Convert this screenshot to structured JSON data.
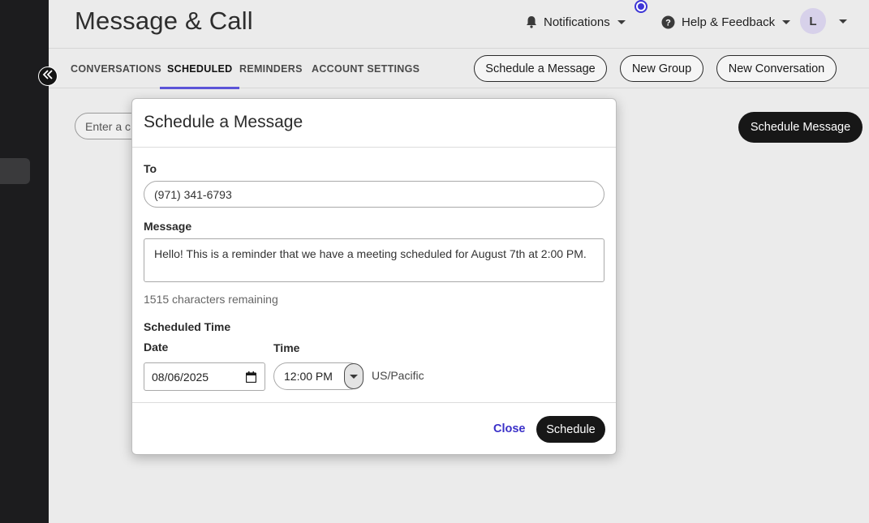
{
  "header": {
    "title": "Message & Call",
    "notifications_label": "Notifications",
    "help_label": "Help & Feedback",
    "avatar_initial": "L"
  },
  "tabs": [
    {
      "label": "CONVERSATIONS",
      "active": false
    },
    {
      "label": "SCHEDULED",
      "active": true
    },
    {
      "label": "REMINDERS",
      "active": false
    },
    {
      "label": "ACCOUNT SETTINGS",
      "active": false
    }
  ],
  "actions": {
    "schedule_a_message": "Schedule a Message",
    "new_group": "New Group",
    "new_conversation": "New Conversation"
  },
  "content": {
    "search_placeholder": "Enter a c",
    "schedule_message_button": "Schedule Message"
  },
  "modal": {
    "title": "Schedule a Message",
    "to_label": "To",
    "to_value": "(971) 341-6793",
    "message_label": "Message",
    "message_value": "Hello! This is a reminder that we have a meeting scheduled for August 7th at 2:00 PM.",
    "chars_remaining": "1515 characters remaining",
    "scheduled_time_label": "Scheduled Time",
    "date_label": "Date",
    "date_value": "08/06/2025",
    "time_label": "Time",
    "time_value": "12:00 PM",
    "timezone": "US/Pacific",
    "close_label": "Close",
    "schedule_label": "Schedule"
  },
  "colors": {
    "accent": "#5b54d8",
    "link": "#3a30c8",
    "sidebar": "#1c1c1e",
    "primary_button": "#171717"
  }
}
